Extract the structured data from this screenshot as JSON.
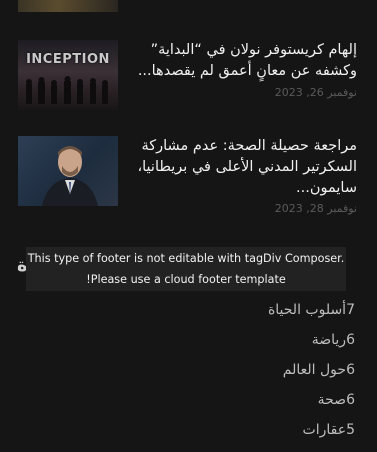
{
  "articles": [
    {
      "title_line1": "إلهام كريستوفر نولان في “البداية”",
      "title_line2": "وكشفه عن معانٍ أعمق لم يقصدها...",
      "date": "نوفمبر 26, 2023",
      "thumb_text": "INCEPTION"
    },
    {
      "title_line1": "مراجعة حصيلة الصحة: عدم مشاركة",
      "title_line2": "السكرتير المدني الأعلى في بريطانيا،",
      "title_line3": "سايمون...",
      "date": "نوفمبر 28, 2023"
    }
  ],
  "footer_notice": {
    "line1": "This type of footer is not editable with tagDiv Composer.",
    "line2": "Please use a cloud footer template!"
  },
  "peek_letter": "ة",
  "categories": [
    {
      "label": "أسلوب الحياة",
      "count": "7"
    },
    {
      "label": "رياضة",
      "count": "6"
    },
    {
      "label": "حول العالم",
      "count": "6"
    },
    {
      "label": "صحة",
      "count": "6"
    },
    {
      "label": "عقارات",
      "count": "5"
    }
  ]
}
